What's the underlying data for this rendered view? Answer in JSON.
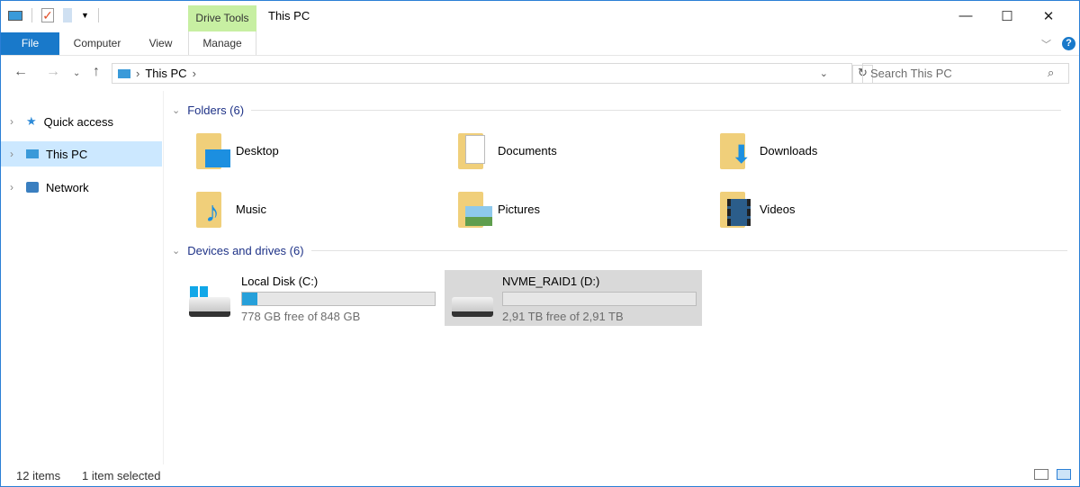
{
  "window": {
    "title": "This PC",
    "minimize": "—",
    "maximize": "☐",
    "close": "✕"
  },
  "ribbon": {
    "context_group": "Drive Tools",
    "tabs": [
      {
        "label": "File"
      },
      {
        "label": "Computer"
      },
      {
        "label": "View"
      },
      {
        "label": "Manage"
      }
    ]
  },
  "address": {
    "path": [
      "This PC"
    ]
  },
  "search": {
    "placeholder": "Search This PC"
  },
  "nav": {
    "items": [
      {
        "label": "Quick access"
      },
      {
        "label": "This PC"
      },
      {
        "label": "Network"
      }
    ]
  },
  "folders": {
    "header": "Folders (6)",
    "items": [
      {
        "label": "Desktop"
      },
      {
        "label": "Documents"
      },
      {
        "label": "Downloads"
      },
      {
        "label": "Music"
      },
      {
        "label": "Pictures"
      },
      {
        "label": "Videos"
      }
    ]
  },
  "drives": {
    "header": "Devices and drives (6)",
    "items": [
      {
        "label": "Local Disk (C:)",
        "free": "778 GB free of 848 GB",
        "used_fraction": 0.08
      },
      {
        "label": "NVME_RAID1 (D:)",
        "free": "2,91 TB free of 2,91 TB",
        "used_fraction": 0.0
      }
    ]
  },
  "status": {
    "count": "12 items",
    "selected": "1 item selected"
  },
  "colors": {
    "accent": "#1979ca",
    "context": "#c7efa2",
    "bar": "#26a0da"
  }
}
